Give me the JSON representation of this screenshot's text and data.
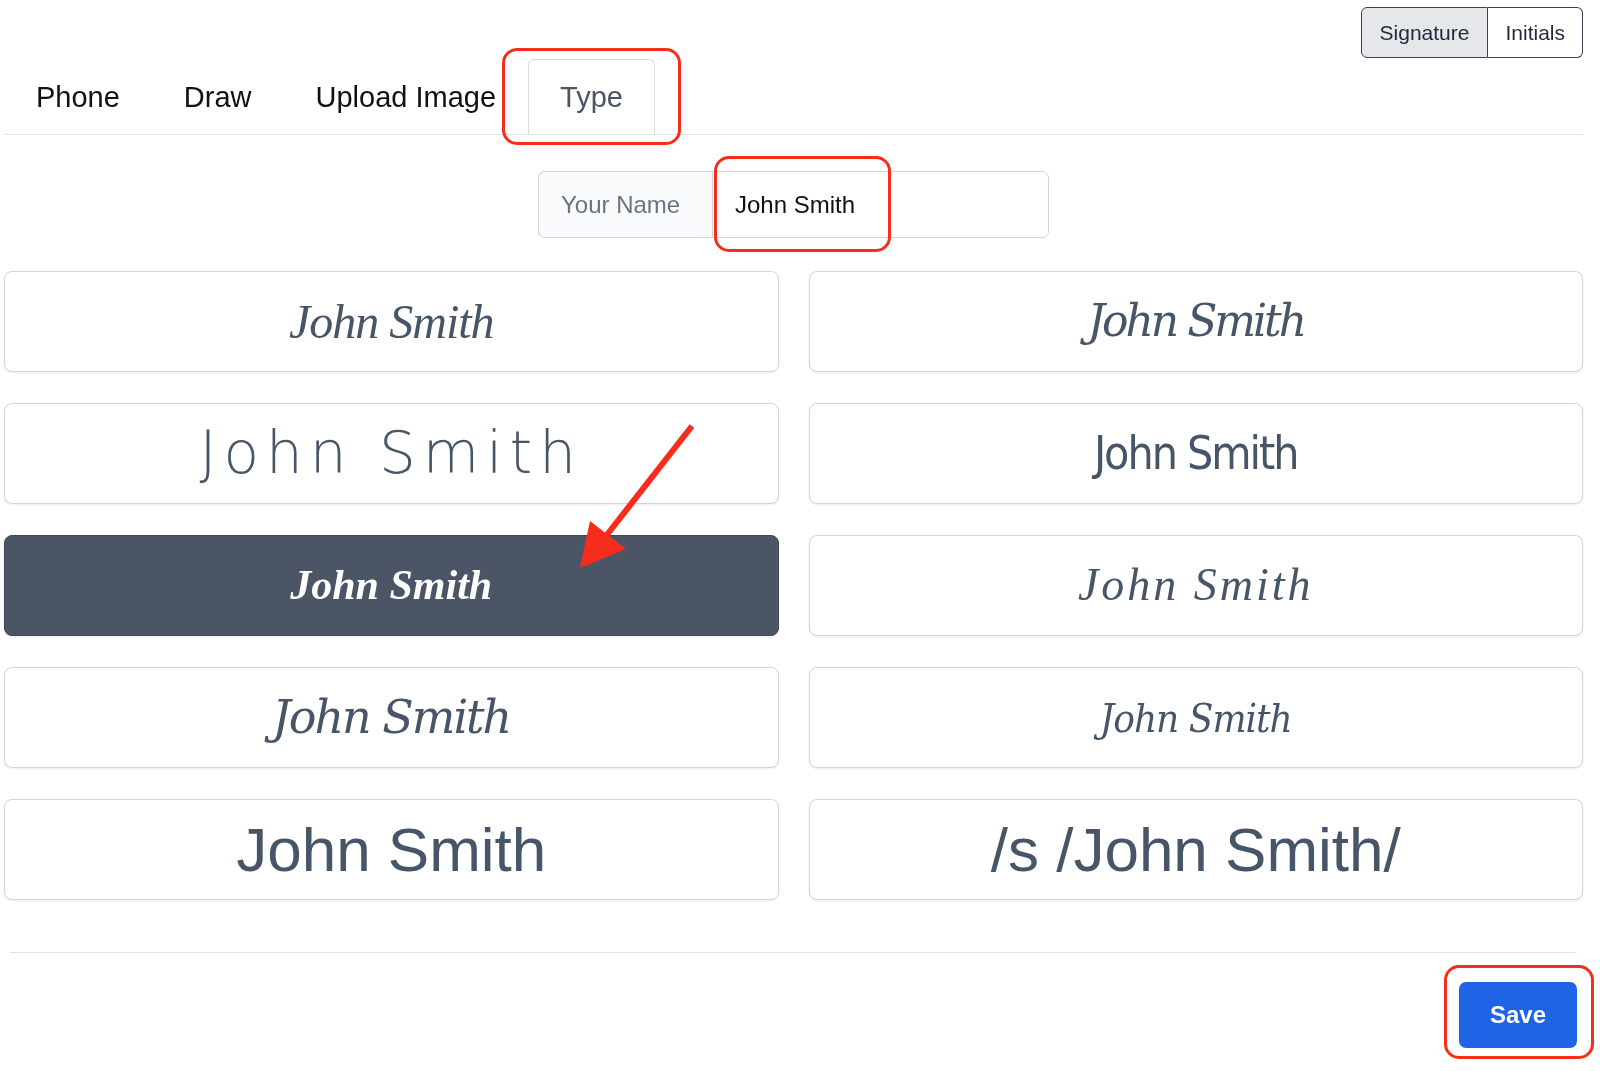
{
  "mode_toggle": [
    {
      "label": "Signature",
      "selected": true
    },
    {
      "label": "Initials",
      "selected": false
    }
  ],
  "tabs": [
    {
      "label": "Phone",
      "selected": false,
      "highlighted": false
    },
    {
      "label": "Draw",
      "selected": false,
      "highlighted": false
    },
    {
      "label": "Upload Image",
      "selected": false,
      "highlighted": false
    },
    {
      "label": "Type",
      "selected": true,
      "highlighted": true
    }
  ],
  "name_field": {
    "label": "Your Name",
    "value": "John Smith",
    "highlighted": true
  },
  "signatures": [
    {
      "text": "John Smith",
      "kind": "script",
      "selected": false,
      "arrow": false
    },
    {
      "text": "John Smith",
      "kind": "script",
      "selected": false,
      "arrow": false
    },
    {
      "text": "John Smith",
      "kind": "script",
      "selected": false,
      "arrow": false
    },
    {
      "text": "John Smith",
      "kind": "script",
      "selected": false,
      "arrow": false
    },
    {
      "text": "John Smith",
      "kind": "script",
      "selected": true,
      "arrow": true
    },
    {
      "text": "John Smith",
      "kind": "script",
      "selected": false,
      "arrow": false
    },
    {
      "text": "John Smith",
      "kind": "script",
      "selected": false,
      "arrow": false
    },
    {
      "text": "John Smith",
      "kind": "script",
      "selected": false,
      "arrow": false
    },
    {
      "text": "John Smith",
      "kind": "typed",
      "selected": false,
      "arrow": false
    },
    {
      "text": "/s /John Smith/",
      "kind": "typed",
      "selected": false,
      "arrow": false
    }
  ],
  "save_button": {
    "label": "Save",
    "highlighted": true
  }
}
